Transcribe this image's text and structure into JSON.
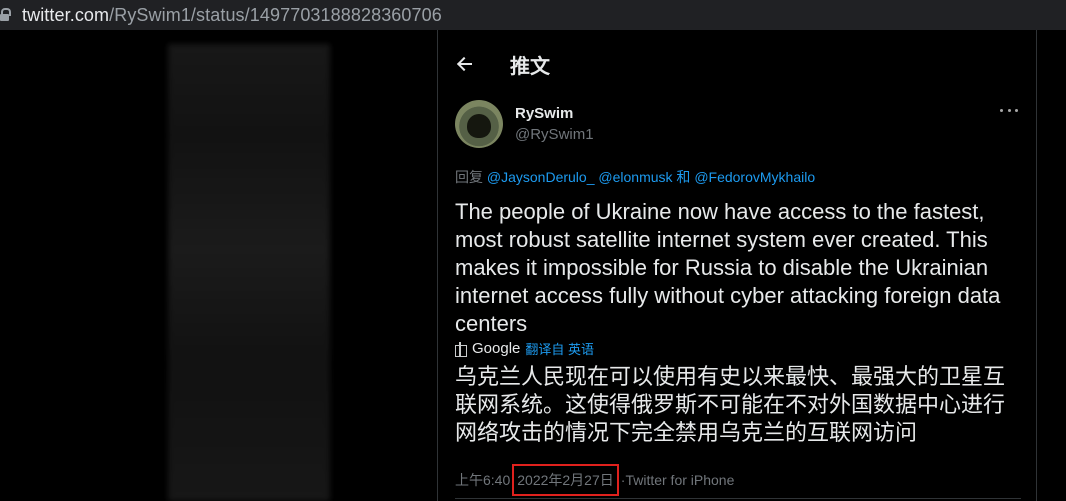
{
  "browser": {
    "url_host": "twitter.com",
    "url_path": "/RySwim1/status/1497703188828360706"
  },
  "header": {
    "title": "推文"
  },
  "tweet": {
    "display_name": "RySwim",
    "handle": "@RySwim1",
    "reply_prefix": "回复",
    "reply_mentions": [
      "@JaysonDerulo_",
      "@elonmusk"
    ],
    "reply_and": "和",
    "reply_last_mention": "@FedorovMykhailo",
    "text": "The people of Ukraine now have access to the fastest, most robust satellite internet system ever created. This makes it impossible for Russia to disable the Ukrainian internet access fully without cyber attacking foreign data centers",
    "translate_provider": "Google",
    "translate_link": "翻译自 英语",
    "translated_text": "乌克兰人民现在可以使用有史以来最快、最强大的卫星互联网系统。这使得俄罗斯不可能在不对外国数据中心进行网络攻击的情况下完全禁用乌克兰的互联网访问",
    "time": "上午6:40",
    "date": "2022年2月27日",
    "source": "Twitter for iPhone"
  }
}
